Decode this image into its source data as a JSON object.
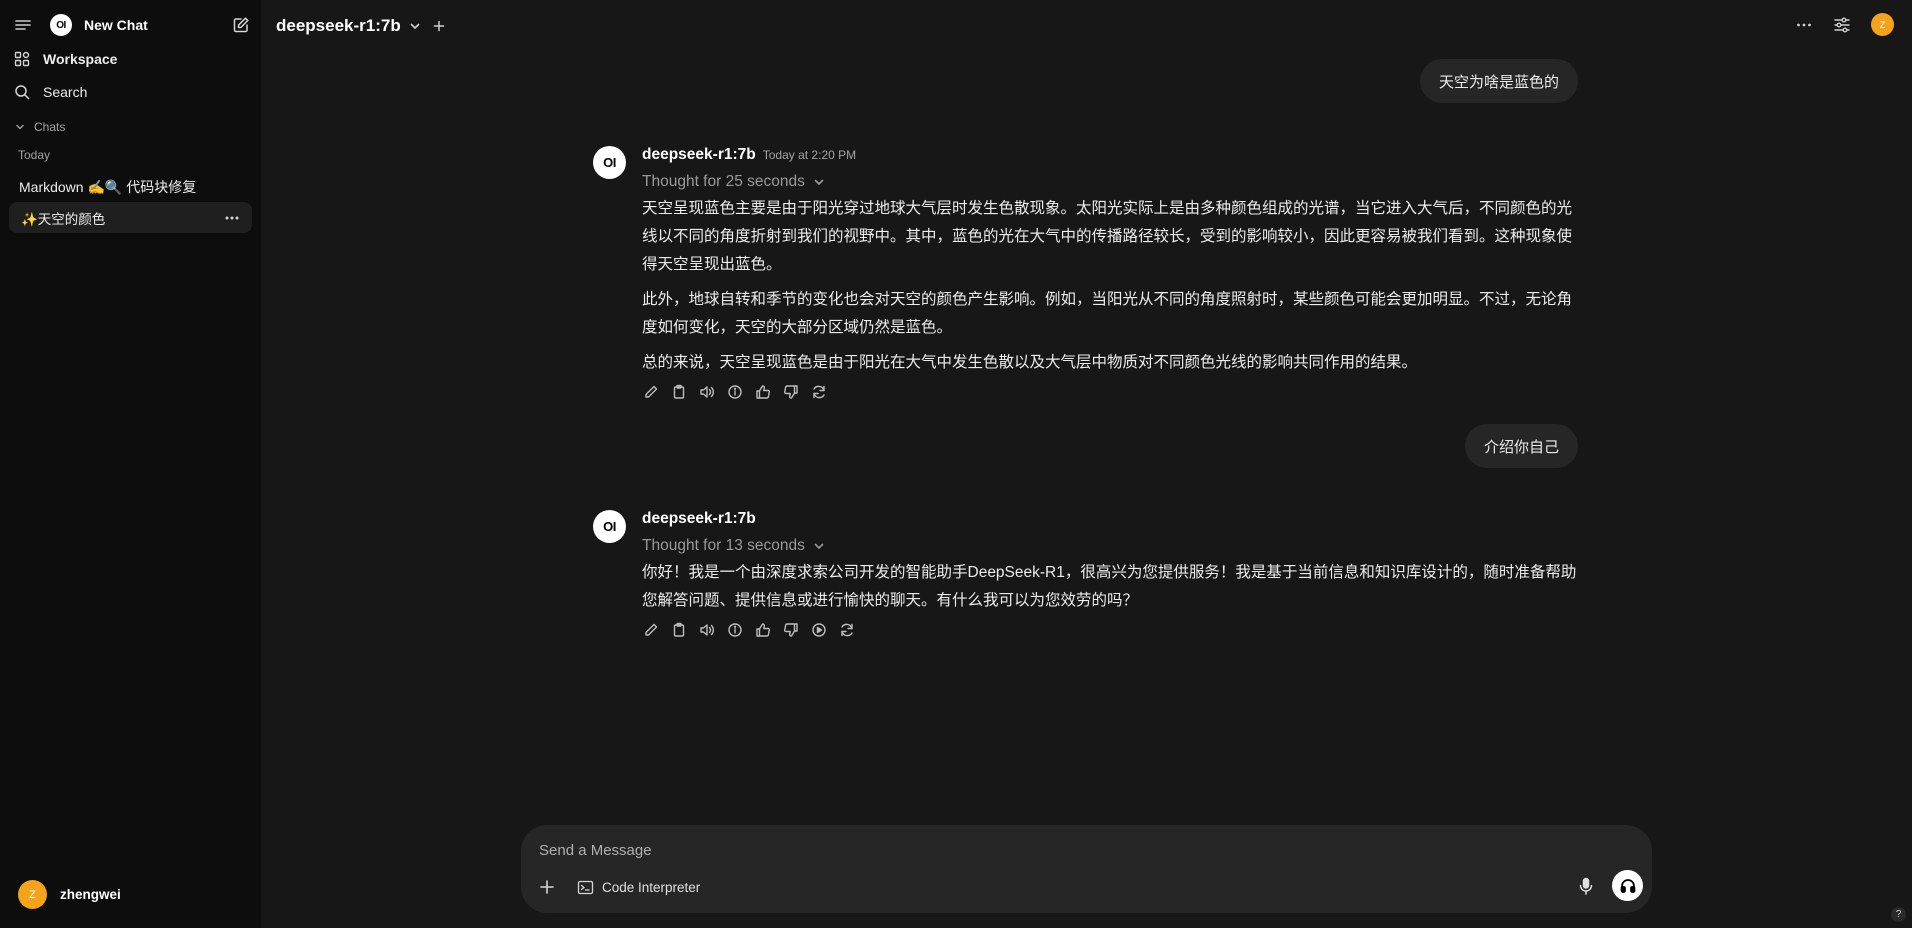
{
  "sidebar": {
    "new_chat_label": "New Chat",
    "workspace_label": "Workspace",
    "search_label": "Search",
    "chats_header": "Chats",
    "today_label": "Today",
    "chats": [
      {
        "title": "Markdown ✍️🔍 代码块修复"
      },
      {
        "title": "✨天空的颜色"
      }
    ],
    "user": {
      "initial": "Z",
      "name": "zhengwei"
    }
  },
  "header": {
    "model_title": "deepseek-r1:7b",
    "avatar_initial": "Z"
  },
  "messages": [
    {
      "role": "user",
      "text": "天空为啥是蓝色的"
    },
    {
      "role": "assistant",
      "avatar_text": "OI",
      "model": "deepseek-r1:7b",
      "time": "Today at 2:20 PM",
      "thought": "Thought for 25 seconds",
      "paragraphs": [
        "天空呈现蓝色主要是由于阳光穿过地球大气层时发生色散现象。太阳光实际上是由多种颜色组成的光谱，当它进入大气后，不同颜色的光线以不同的角度折射到我们的视野中。其中，蓝色的光在大气中的传播路径较长，受到的影响较小，因此更容易被我们看到。这种现象使得天空呈现出蓝色。",
        "此外，地球自转和季节的变化也会对天空的颜色产生影响。例如，当阳光从不同的角度照射时，某些颜色可能会更加明显。不过，无论角度如何变化，天空的大部分区域仍然是蓝色。",
        "总的来说，天空呈现蓝色是由于阳光在大气中发生色散以及大气层中物质对不同颜色光线的影响共同作用的结果。"
      ]
    },
    {
      "role": "user",
      "text": "介绍你自己"
    },
    {
      "role": "assistant",
      "avatar_text": "OI",
      "model": "deepseek-r1:7b",
      "thought": "Thought for 13 seconds",
      "paragraphs": [
        "你好！我是一个由深度求索公司开发的智能助手DeepSeek-R1，很高兴为您提供服务！我是基于当前信息和知识库设计的，随时准备帮助您解答问题、提供信息或进行愉快的聊天。有什么我可以为您效劳的吗？"
      ]
    }
  ],
  "composer": {
    "placeholder": "Send a Message",
    "value": "",
    "code_interpreter_label": "Code Interpreter"
  },
  "logo_text": "OI",
  "help_label": "?"
}
